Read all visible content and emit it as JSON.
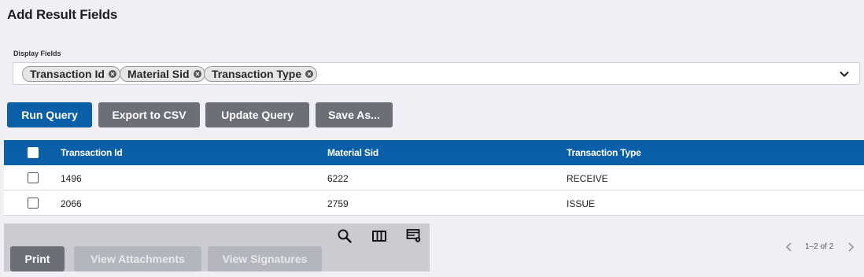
{
  "page": {
    "title": "Add Result Fields"
  },
  "display_fields": {
    "label": "Display Fields",
    "chips": [
      "Transaction Id",
      "Material Sid",
      "Transaction Type"
    ]
  },
  "actions": {
    "run_query": "Run Query",
    "export_csv": "Export to CSV",
    "update_query": "Update Query",
    "save_as": "Save As..."
  },
  "table": {
    "columns": [
      "Transaction Id",
      "Material Sid",
      "Transaction Type"
    ],
    "rows": [
      [
        "1496",
        "6222",
        "RECEIVE"
      ],
      [
        "2066",
        "2759",
        "ISSUE"
      ]
    ]
  },
  "footer": {
    "print": "Print",
    "view_attachments": "View Attachments",
    "view_signatures": "View Signatures",
    "pagination": "1–2 of 2"
  },
  "icons": {
    "search": "search-icon",
    "columns": "columns-icon",
    "settings": "table-settings-icon"
  },
  "colors": {
    "primary": "#0b5fa8",
    "secondary_button": "#6c6f78",
    "background": "#f0eff5"
  }
}
